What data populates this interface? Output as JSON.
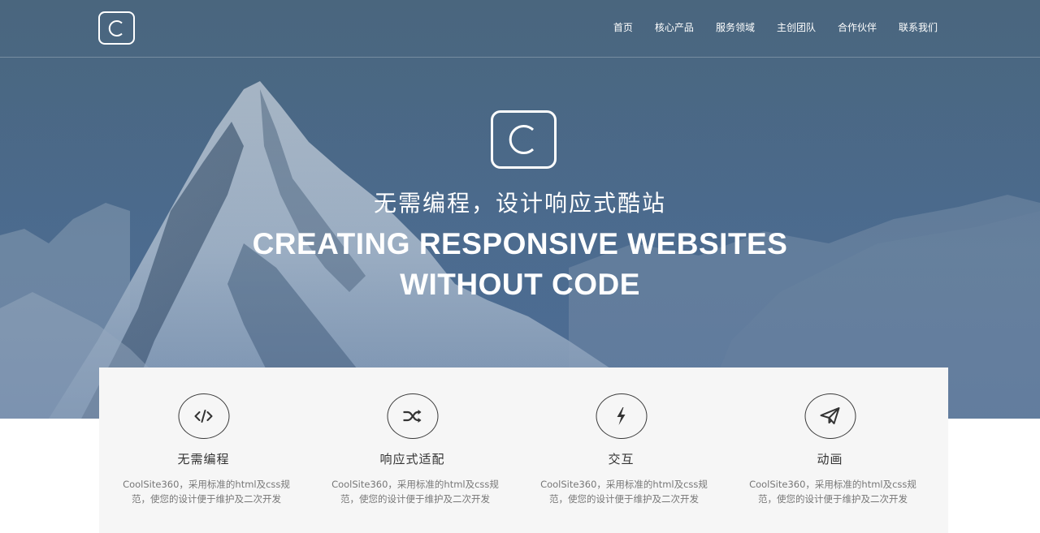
{
  "nav": {
    "items": [
      {
        "label": "首页"
      },
      {
        "label": "核心产品"
      },
      {
        "label": "服务领域"
      },
      {
        "label": "主创团队"
      },
      {
        "label": "合作伙伴"
      },
      {
        "label": "联系我们"
      }
    ]
  },
  "logo": {
    "letter": "C"
  },
  "hero": {
    "logo_letter": "C",
    "subtitle_cn": "无需编程，设计响应式酷站",
    "title_en_line1": "CREATING RESPONSIVE WEBSITES",
    "title_en_line2": "WITHOUT CODE"
  },
  "features": [
    {
      "icon": "code-icon",
      "title": "无需编程",
      "desc": "CoolSite360，采用标准的html及css规范，使您的设计便于维护及二次开发"
    },
    {
      "icon": "shuffle-icon",
      "title": "响应式适配",
      "desc": "CoolSite360，采用标准的html及css规范，使您的设计便于维护及二次开发"
    },
    {
      "icon": "bolt-icon",
      "title": "交互",
      "desc": "CoolSite360，采用标准的html及css规范，使您的设计便于维护及二次开发"
    },
    {
      "icon": "paper-plane-icon",
      "title": "动画",
      "desc": "CoolSite360，采用标准的html及css规范，使您的设计便于维护及二次开发"
    }
  ],
  "colors": {
    "hero_blue": "#4d6f93",
    "panel_bg": "#f6f6f6",
    "text_dark": "#333333",
    "text_muted": "#777777"
  }
}
